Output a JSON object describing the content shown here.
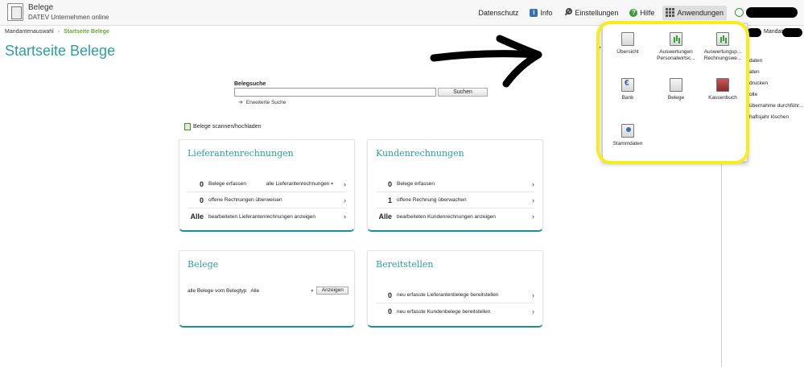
{
  "app": {
    "title": "Belege",
    "subtitle": "DATEV Unternehmen online"
  },
  "topnav": {
    "datenschutz": "Datenschutz",
    "info": "Info",
    "einstellungen": "Einstellungen",
    "hilfe": "Hilfe",
    "anwendungen": "Anwendungen"
  },
  "breadcrumb": {
    "parent": "Mandantenauswahl",
    "current": "Startseite Belege"
  },
  "page_title": "Startseite Belege",
  "search": {
    "label": "Belegsuche",
    "value": "",
    "button": "Suchen",
    "extended": "Erweiterte Suche"
  },
  "upload_link": "Belege scannen/hochladen",
  "cards": {
    "lieferanten": {
      "title": "Lieferantenrechnungen",
      "rows": [
        {
          "num": "0",
          "text": "Belege erfassen",
          "dropdown": "alle Lieferantenrechnungen"
        },
        {
          "num": "0",
          "text": "offene Rechnungen überweisen"
        },
        {
          "num": "Alle",
          "text": "bearbeiteten Lieferantenrechnungen anzeigen"
        }
      ]
    },
    "kunden": {
      "title": "Kundenrechnungen",
      "rows": [
        {
          "num": "0",
          "text": "Belege erfassen"
        },
        {
          "num": "1",
          "text": "offene Rechnung überwachen"
        },
        {
          "num": "Alle",
          "text": "bearbeiteten Kundenrechnungen anzeigen"
        }
      ]
    },
    "belege": {
      "title": "Belege",
      "label": "alle Belege vom Belegtyp",
      "select_value": "Alle",
      "button": "Anzeigen"
    },
    "bereitstellen": {
      "title": "Bereitstellen",
      "rows": [
        {
          "num": "0",
          "text": "neu erfasste Lieferantenbelege bereitstellen"
        },
        {
          "num": "0",
          "text": "neu erfasste Kundenbelege bereitstellen"
        }
      ]
    }
  },
  "anwendungen_menu": {
    "tiles": [
      {
        "label": "Übersicht",
        "icon": "overview-icon"
      },
      {
        "label": "Auswertungen Personalwirtsc...",
        "icon": "payroll-reports-icon"
      },
      {
        "label": "Auswertungsp... Rechnungswe...",
        "icon": "accounting-reports-icon"
      },
      {
        "label": "Bank",
        "icon": "bank-icon"
      },
      {
        "label": "Belege",
        "icon": "documents-icon"
      },
      {
        "label": "Kassenbuch",
        "icon": "cashbook-icon"
      },
      {
        "label": "Stammdaten",
        "icon": "master-data-icon"
      }
    ]
  },
  "right_panel": {
    "mandant": "Mandant",
    "items": [
      "daten",
      "aten",
      "drucken",
      "olle",
      "übernahme durchführ...",
      "haftsjahr löschen"
    ]
  },
  "colors": {
    "accent": "#2e9da0",
    "breadcrumb_current": "#6aa53a",
    "highlight": "#f5ee1b"
  }
}
